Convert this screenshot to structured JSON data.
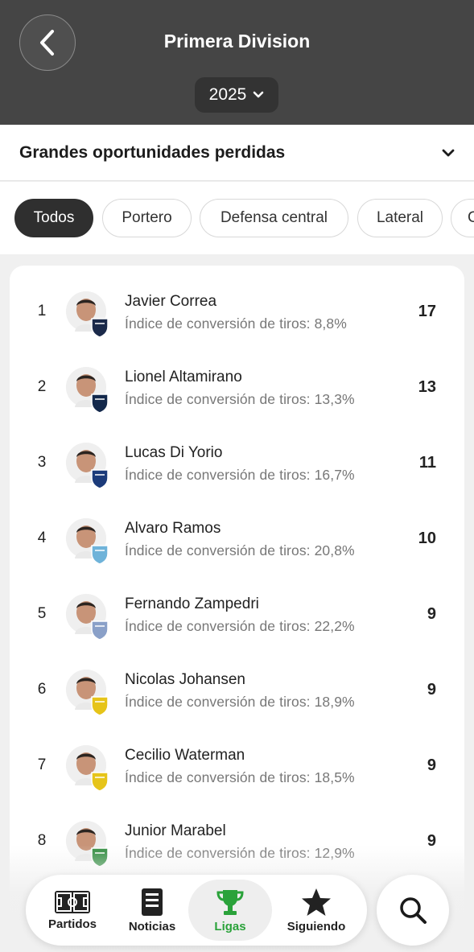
{
  "header": {
    "title": "Primera Division",
    "season": "2025"
  },
  "stat_selector": {
    "label": "Grandes oportunidades perdidas"
  },
  "filters": [
    {
      "label": "Todos",
      "active": true
    },
    {
      "label": "Portero",
      "active": false
    },
    {
      "label": "Defensa central",
      "active": false
    },
    {
      "label": "Lateral",
      "active": false
    },
    {
      "label": "C",
      "active": false
    }
  ],
  "players": [
    {
      "rank": "1",
      "name": "Javier Correa",
      "stat": "Índice de conversión de tiros: 8,8%",
      "value": "17",
      "club_color": "#1b2a4a"
    },
    {
      "rank": "2",
      "name": "Lionel Altamirano",
      "stat": "Índice de conversión de tiros: 13,3%",
      "value": "13",
      "club_color": "#13284b"
    },
    {
      "rank": "3",
      "name": "Lucas Di Yorio",
      "stat": "Índice de conversión de tiros: 16,7%",
      "value": "11",
      "club_color": "#1c3b7a"
    },
    {
      "rank": "4",
      "name": "Alvaro Ramos",
      "stat": "Índice de conversión de tiros: 20,8%",
      "value": "10",
      "club_color": "#6fb3d9"
    },
    {
      "rank": "5",
      "name": "Fernando Zampedri",
      "stat": "Índice de conversión de tiros: 22,2%",
      "value": "9",
      "club_color": "#8aa0c8"
    },
    {
      "rank": "6",
      "name": "Nicolas Johansen",
      "stat": "Índice de conversión de tiros: 18,9%",
      "value": "9",
      "club_color": "#e6c419"
    },
    {
      "rank": "7",
      "name": "Cecilio Waterman",
      "stat": "Índice de conversión de tiros: 18,5%",
      "value": "9",
      "club_color": "#e6c419"
    },
    {
      "rank": "8",
      "name": "Junior Marabel",
      "stat": "Índice de conversión de tiros: 12,9%",
      "value": "9",
      "club_color": "#2e8b3d"
    }
  ],
  "nav": {
    "tabs": [
      {
        "label": "Partidos",
        "icon": "pitch-icon"
      },
      {
        "label": "Noticias",
        "icon": "news-icon"
      },
      {
        "label": "Ligas",
        "icon": "trophy-icon"
      },
      {
        "label": "Siguiendo",
        "icon": "star-icon"
      }
    ],
    "active_tab": "Ligas",
    "accent_color": "#2aa23a"
  }
}
